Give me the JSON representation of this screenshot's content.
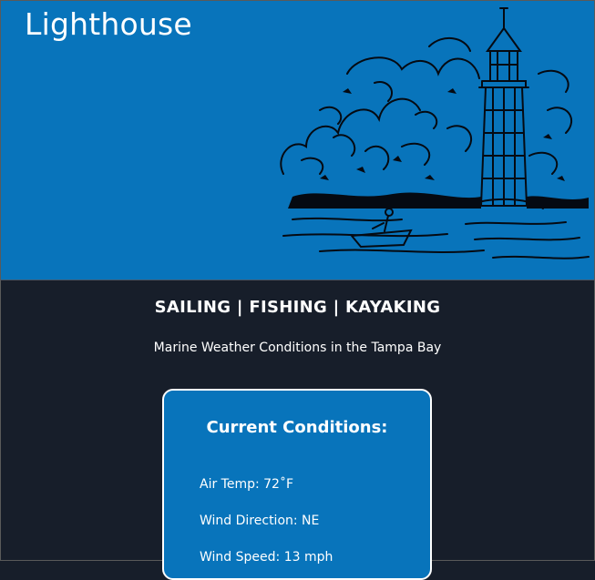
{
  "site": {
    "title": "Lighthouse"
  },
  "header": {
    "illustration_icon": "lighthouse-illustration"
  },
  "tagline": "SAILING | FISHING | KAYAKING",
  "subtitle": "Marine Weather Conditions in the Tampa Bay",
  "conditions": {
    "title": "Current Conditions:",
    "air_temp": "Air Temp: 72˚F",
    "wind_direction": "Wind Direction: NE",
    "wind_speed": "Wind Speed: 13 mph"
  },
  "colors": {
    "brand_blue": "#0874bb",
    "page_background": "#171e2a",
    "text": "#ffffff"
  }
}
